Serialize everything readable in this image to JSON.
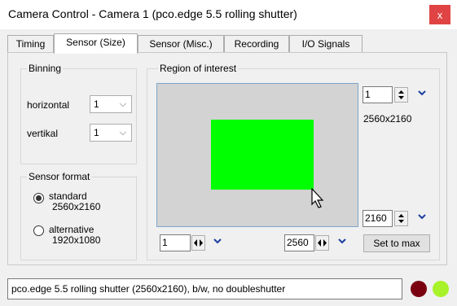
{
  "window": {
    "title": "Camera Control - Camera 1 (pco.edge 5.5 rolling shutter)",
    "close_glyph": "x"
  },
  "tabs": [
    {
      "label": "Timing"
    },
    {
      "label": "Sensor (Size)"
    },
    {
      "label": "Sensor (Misc.)"
    },
    {
      "label": "Recording"
    },
    {
      "label": "I/O Signals"
    }
  ],
  "binning": {
    "legend": "Binning",
    "horizontal_label": "horizontal",
    "horizontal_value": "1",
    "vertical_label": "vertikal",
    "vertical_value": "1"
  },
  "sensor_format": {
    "legend": "Sensor format",
    "standard_label": "standard",
    "standard_size": "2560x2160",
    "alternative_label": "alternative",
    "alternative_size": "1920x1080",
    "selected": "standard"
  },
  "roi": {
    "legend": "Region of interest",
    "top_value": "1",
    "size_text": "2560x2160",
    "bottom_value": "2160",
    "left_value": "1",
    "right_value": "2560",
    "set_max_label": "Set to max"
  },
  "status": {
    "text": "pco.edge 5.5 rolling shutter (2560x2160), b/w, no doubleshutter",
    "led1_color": "#7a0010",
    "led2_color": "#a8f22a"
  },
  "colors": {
    "roi_green": "#00ff00",
    "close_red": "#e04343"
  }
}
